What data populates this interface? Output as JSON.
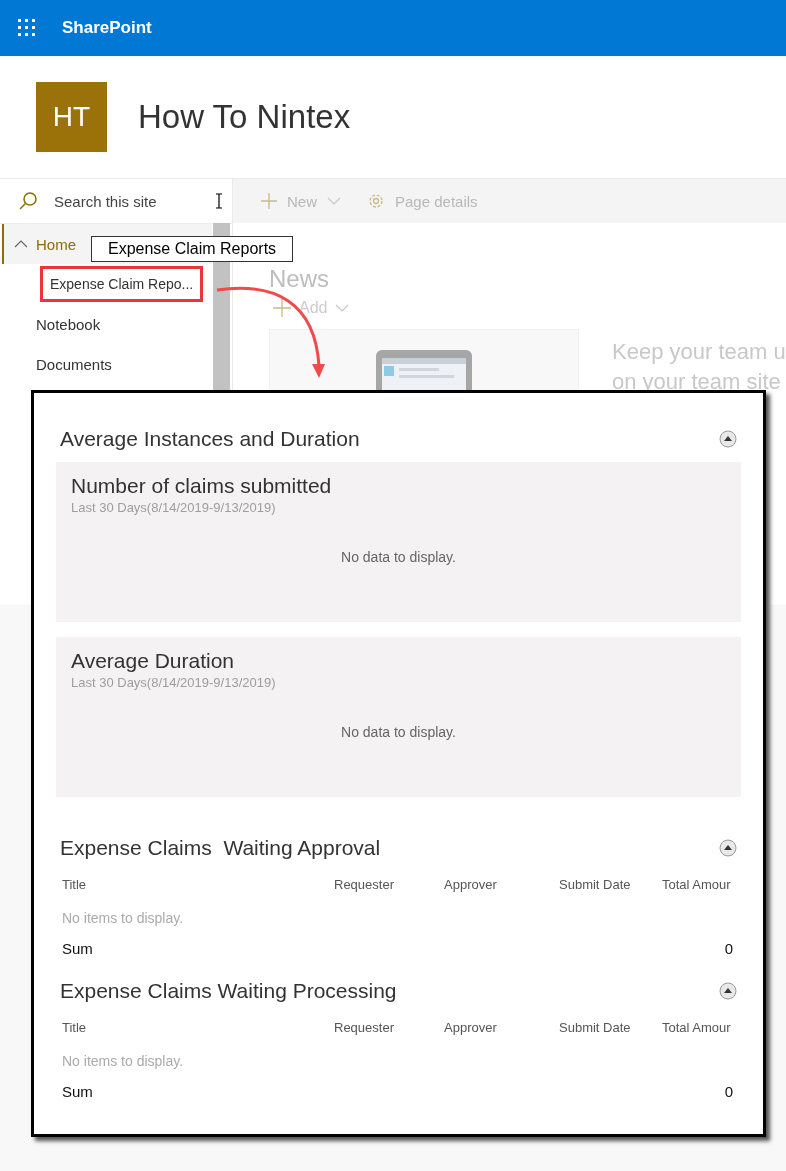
{
  "app_bar": {
    "app_name": "SharePoint"
  },
  "site": {
    "logo_initials": "HT",
    "title": "How To Nintex"
  },
  "search": {
    "placeholder": "Search this site"
  },
  "command_bar": [
    {
      "kind": "new",
      "label": "New"
    },
    {
      "kind": "details",
      "label": "Page details"
    }
  ],
  "nav": [
    {
      "label": "Home",
      "selected": true,
      "expanded": true,
      "children": [
        {
          "label": "Expense Claim Repo...",
          "selected": false,
          "highlighted": true
        }
      ]
    },
    {
      "label": "Notebook",
      "selected": false
    },
    {
      "label": "Documents",
      "selected": false
    }
  ],
  "callout": {
    "tooltip": "Expense Claim Reports"
  },
  "news": {
    "title": "News",
    "add_label": "Add",
    "card": {
      "kind": "picture"
    },
    "promo_lines": [
      "Keep your team u",
      "on your team site"
    ]
  },
  "report": {
    "sections": [
      {
        "kind": "charts",
        "title": "Average Instances and Duration",
        "collapsed": false,
        "charts": [
          {
            "title": "Number of claims submitted",
            "subtitle": "Last 30 Days(8/14/2019-9/13/2019)",
            "empty_text": "No data to display."
          },
          {
            "title": "Average Duration",
            "subtitle": "Last 30 Days(8/14/2019-9/13/2019)",
            "empty_text": "No data to display."
          }
        ]
      },
      {
        "kind": "list",
        "title": "Expense Claims  Waiting Approval",
        "collapsed": false,
        "columns": [
          "Title",
          "Requester",
          "Approver",
          "Submit Date",
          "Total Amour"
        ],
        "empty_text": "No items to display.",
        "sum_label": "Sum",
        "sum_value": "0"
      },
      {
        "kind": "list",
        "title": "Expense Claims Waiting Processing",
        "collapsed": false,
        "columns": [
          "Title",
          "Requester",
          "Approver",
          "Submit Date",
          "Total Amour"
        ],
        "empty_text": "No items to display.",
        "sum_label": "Sum",
        "sum_value": "0"
      }
    ]
  }
}
